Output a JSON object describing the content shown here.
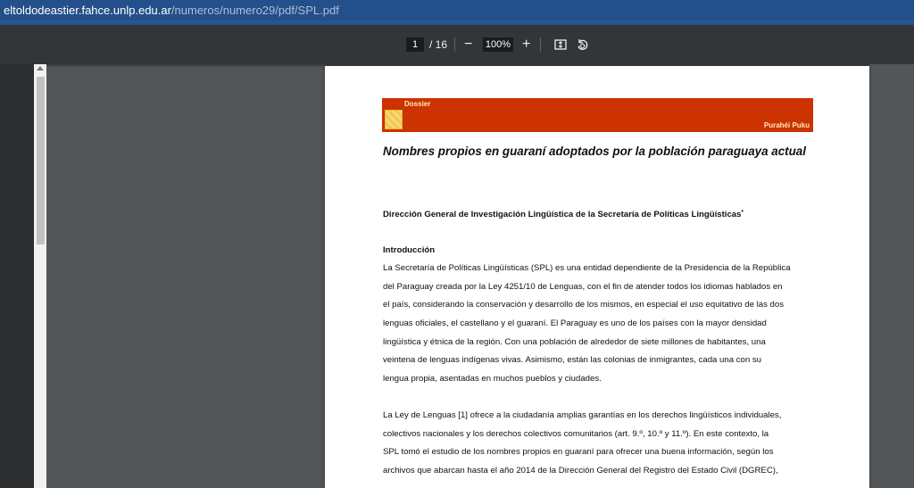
{
  "url": {
    "host": "eltoldodeastier.fahce.unlp.edu.ar",
    "path": "/numeros/numero29/pdf/SPL.pdf"
  },
  "toolbar": {
    "current_page": "1",
    "page_total": "/ 16",
    "zoom_out": "−",
    "zoom": "100%",
    "zoom_in": "+",
    "icons": [
      "fit-page-icon",
      "rotate-icon"
    ]
  },
  "banner": {
    "section": "Dossier",
    "journal": "Purahéi Puku",
    "color": "#cc3300"
  },
  "document": {
    "title": "Nombres propios en guaraní adoptados por la población paraguaya actual",
    "author": "Dirección General de Investigación Lingüística de la Secretaría de Políticas Lingüísticas",
    "author_mark": "•",
    "section_heading": "Introducción",
    "paragraph1": [
      "La Secretaría de Políticas Lingüísticas (SPL) es una entidad dependiente de la Presidencia de la República",
      "del Paraguay creada por la Ley 4251/10 de Lenguas, con el fin de atender todos los idiomas hablados en",
      "el país, considerando la conservación y desarrollo de los mismos, en especial el uso equitativo de las dos",
      "lenguas oficiales, el castellano y el guaraní. El Paraguay es uno de los países con la mayor densidad",
      "lingüística y étnica de la región. Con una población de alrededor de siete millones de habitantes, una",
      "veintena de lenguas indígenas vivas. Asimismo, están las colonias de inmigrantes, cada una con su",
      "lengua propia, asentadas en muchos pueblos y ciudades."
    ],
    "paragraph2": [
      "La Ley de Lenguas [1] ofrece a la ciudadanía amplias garantías en los derechos lingüísticos individuales,",
      "colectivos nacionales y los derechos colectivos comunitarios (art. 9.º, 10.º y 11.º). En este contexto, la",
      "SPL tomó el estudio de los nombres propios en guaraní para ofrecer una buena información, según los",
      "archivos que abarcan hasta el año 2014 de la Dirección General del Registro del Estado Civil (DGREC),"
    ]
  }
}
